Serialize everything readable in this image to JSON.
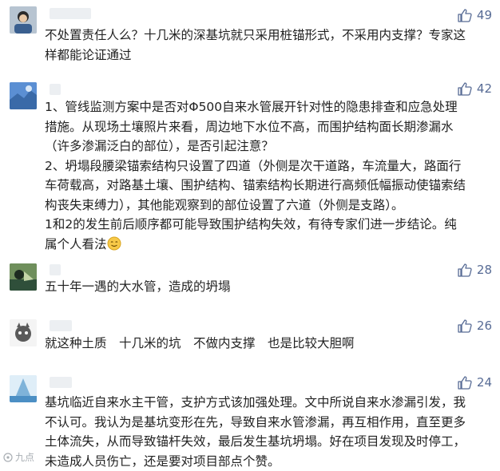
{
  "comments": [
    {
      "likes": "49",
      "lines": [
        "不处置责任人么？十几米的深基坑就只采用桩锚形式，不采用内支撑？专家这",
        "样都能论证通过"
      ]
    },
    {
      "likes": "42",
      "lines": [
        "1、管线监测方案中是否对Φ500自来水管展开针对性的隐患排查和应急处理",
        "措施。从现场土壤照片来看，周边地下水位不高，而围护结构面长期渗漏水",
        "（许多渗漏泛白的部位），是否引起注意？",
        "2、坍塌段腰梁锚索结构只设置了四道（外侧是次干道路，车流量大，路面行",
        "车荷载高，对路基土壤、围护结构、锚索结构长期进行高频低幅振动使锚索结",
        "构丧失束缚力），其他能观察到的部位设置了六道（外侧是支路）。",
        "1和2的发生前后顺序都可能导致围护结构失效，有待专家们进一步结论。纯",
        "属个人看法"
      ]
    },
    {
      "likes": "28",
      "lines": [
        "五十年一遇的大水管，造成的坍塌"
      ]
    },
    {
      "likes": "26",
      "lines": [
        "就这种土质　十几米的坑　不做内支撑　也是比较大胆啊"
      ]
    },
    {
      "likes": "24",
      "lines": [
        "基坑临近自来水主干管，支护方式该加强处理。文中所说自来水渗漏引发，我",
        "不认可。我认为是基坑变形在先，导致自来水管渗漏，再互相作用，直至更多",
        "土体流失，从而导致锚杆失效，最后发生基坑坍塌。好在项目发现及时停工，",
        "未造成人员伤亡，还是要对项目部点个赞。"
      ]
    }
  ],
  "watermark": "九点"
}
